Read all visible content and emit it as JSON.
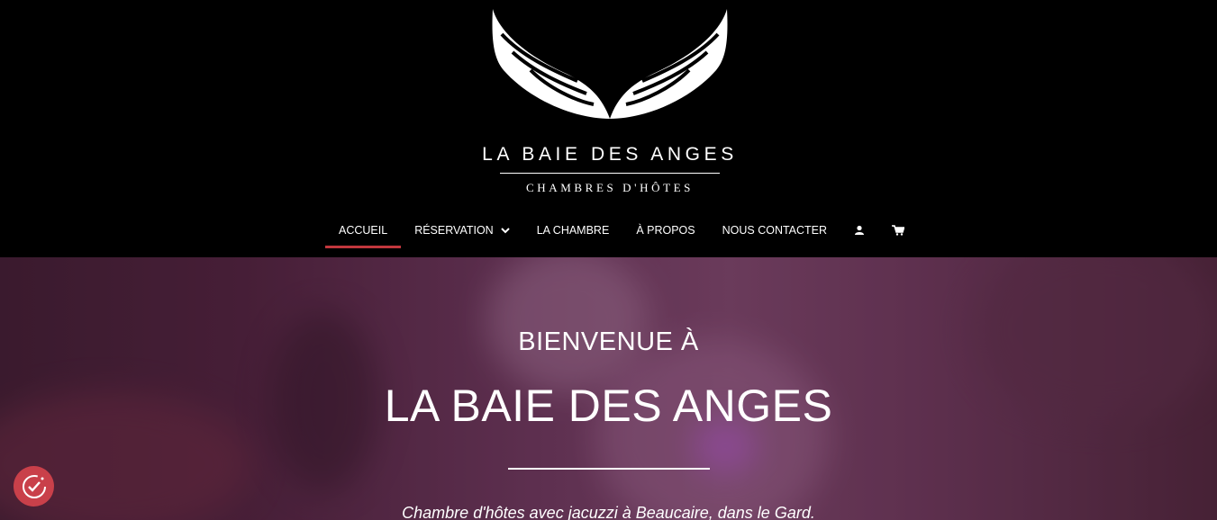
{
  "logo": {
    "title": "LA BAIE DES ANGES",
    "subtitle": "CHAMBRES D'HÔTES",
    "icon": "angel-wings-icon"
  },
  "nav": {
    "items": [
      {
        "label": "ACCUEIL",
        "active": true
      },
      {
        "label": "RÉSERVATION",
        "has_dropdown": true
      },
      {
        "label": "LA CHAMBRE"
      },
      {
        "label": "À PROPOS"
      },
      {
        "label": "NOUS CONTACTER"
      }
    ],
    "icons": [
      "user-icon",
      "cart-icon"
    ]
  },
  "hero": {
    "kicker": "BIENVENUE À",
    "title": "LA BAIE DES ANGES",
    "subtitle": "Chambre d'hôtes avec jacuzzi à Beaucaire, dans le Gard."
  },
  "consent": {
    "icon": "cookie-consent-icon"
  },
  "colors": {
    "accent": "#c2373d",
    "header_bg": "#000000",
    "consent_bg": "#c9404a"
  }
}
